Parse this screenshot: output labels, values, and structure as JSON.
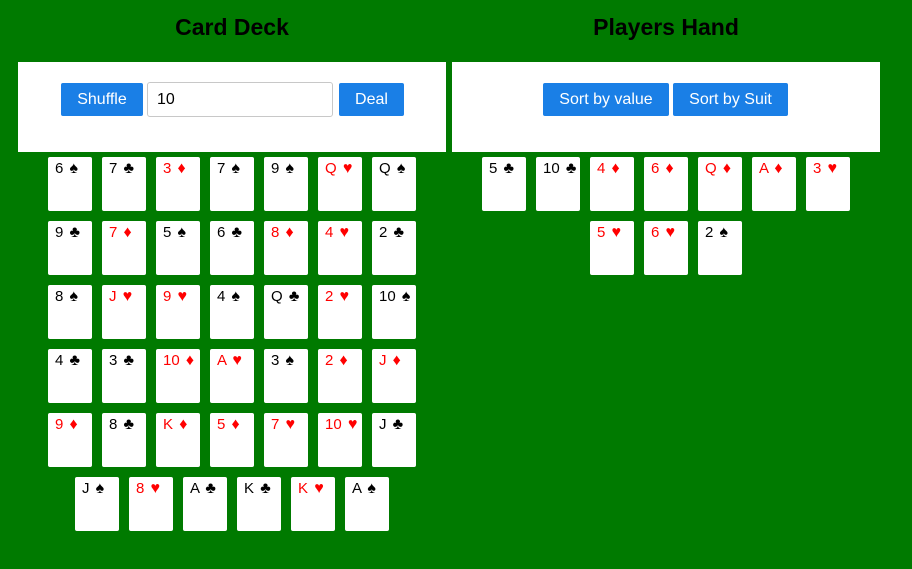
{
  "deck": {
    "title": "Card Deck",
    "shuffle_label": "Shuffle",
    "count_value": "10",
    "deal_label": "Deal",
    "cards": [
      {
        "rank": "6",
        "suit": "♠",
        "color": "black"
      },
      {
        "rank": "7",
        "suit": "♣",
        "color": "black"
      },
      {
        "rank": "3",
        "suit": "♦",
        "color": "red"
      },
      {
        "rank": "7",
        "suit": "♠",
        "color": "black"
      },
      {
        "rank": "9",
        "suit": "♠",
        "color": "black"
      },
      {
        "rank": "Q",
        "suit": "♥",
        "color": "red"
      },
      {
        "rank": "Q",
        "suit": "♠",
        "color": "black"
      },
      {
        "rank": "9",
        "suit": "♣",
        "color": "black"
      },
      {
        "rank": "7",
        "suit": "♦",
        "color": "red"
      },
      {
        "rank": "5",
        "suit": "♠",
        "color": "black"
      },
      {
        "rank": "6",
        "suit": "♣",
        "color": "black"
      },
      {
        "rank": "8",
        "suit": "♦",
        "color": "red"
      },
      {
        "rank": "4",
        "suit": "♥",
        "color": "red"
      },
      {
        "rank": "2",
        "suit": "♣",
        "color": "black"
      },
      {
        "rank": "8",
        "suit": "♠",
        "color": "black"
      },
      {
        "rank": "J",
        "suit": "♥",
        "color": "red"
      },
      {
        "rank": "9",
        "suit": "♥",
        "color": "red"
      },
      {
        "rank": "4",
        "suit": "♠",
        "color": "black"
      },
      {
        "rank": "Q",
        "suit": "♣",
        "color": "black"
      },
      {
        "rank": "2",
        "suit": "♥",
        "color": "red"
      },
      {
        "rank": "10",
        "suit": "♠",
        "color": "black"
      },
      {
        "rank": "4",
        "suit": "♣",
        "color": "black"
      },
      {
        "rank": "3",
        "suit": "♣",
        "color": "black"
      },
      {
        "rank": "10",
        "suit": "♦",
        "color": "red"
      },
      {
        "rank": "A",
        "suit": "♥",
        "color": "red"
      },
      {
        "rank": "3",
        "suit": "♠",
        "color": "black"
      },
      {
        "rank": "2",
        "suit": "♦",
        "color": "red"
      },
      {
        "rank": "J",
        "suit": "♦",
        "color": "red"
      },
      {
        "rank": "9",
        "suit": "♦",
        "color": "red"
      },
      {
        "rank": "8",
        "suit": "♣",
        "color": "black"
      },
      {
        "rank": "K",
        "suit": "♦",
        "color": "red"
      },
      {
        "rank": "5",
        "suit": "♦",
        "color": "red"
      },
      {
        "rank": "7",
        "suit": "♥",
        "color": "red"
      },
      {
        "rank": "10",
        "suit": "♥",
        "color": "red"
      },
      {
        "rank": "J",
        "suit": "♣",
        "color": "black"
      },
      {
        "rank": "J",
        "suit": "♠",
        "color": "black"
      },
      {
        "rank": "8",
        "suit": "♥",
        "color": "red"
      },
      {
        "rank": "A",
        "suit": "♣",
        "color": "black"
      },
      {
        "rank": "K",
        "suit": "♣",
        "color": "black"
      },
      {
        "rank": "K",
        "suit": "♥",
        "color": "red"
      },
      {
        "rank": "A",
        "suit": "♠",
        "color": "black"
      }
    ]
  },
  "hand": {
    "title": "Players Hand",
    "sort_value_label": "Sort by value",
    "sort_suit_label": "Sort by Suit",
    "cards": [
      {
        "rank": "5",
        "suit": "♣",
        "color": "black"
      },
      {
        "rank": "10",
        "suit": "♣",
        "color": "black"
      },
      {
        "rank": "4",
        "suit": "♦",
        "color": "red"
      },
      {
        "rank": "6",
        "suit": "♦",
        "color": "red"
      },
      {
        "rank": "Q",
        "suit": "♦",
        "color": "red"
      },
      {
        "rank": "A",
        "suit": "♦",
        "color": "red"
      },
      {
        "rank": "3",
        "suit": "♥",
        "color": "red"
      },
      {
        "rank": "5",
        "suit": "♥",
        "color": "red"
      },
      {
        "rank": "6",
        "suit": "♥",
        "color": "red"
      },
      {
        "rank": "2",
        "suit": "♠",
        "color": "black"
      }
    ]
  },
  "colors": {
    "table_green": "#007a00",
    "button_blue": "#1a7fe6",
    "red_suit": "#ff0000",
    "black_suit": "#000000"
  }
}
